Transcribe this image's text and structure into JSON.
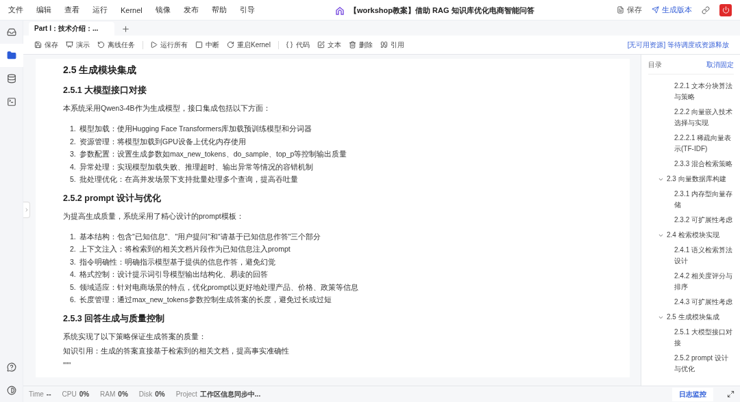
{
  "menu": [
    "文件",
    "编辑",
    "查看",
    "运行",
    "Kernel",
    "镜像",
    "发布",
    "帮助",
    "引导"
  ],
  "title": "【workshop教案】借助 RAG 知识库优化电商智能问答",
  "header_actions": [
    {
      "kind": "save",
      "label": "保存"
    },
    {
      "kind": "publish",
      "label": "生成版本"
    },
    {
      "kind": "link"
    },
    {
      "kind": "power"
    }
  ],
  "sidebar": [
    {
      "kind": "inbox",
      "selected": false
    },
    {
      "kind": "folder",
      "selected": true
    },
    {
      "kind": "database",
      "selected": false
    },
    {
      "kind": "terminal",
      "selected": false
    }
  ],
  "sidebar_bottom": [
    {
      "kind": "help"
    },
    {
      "kind": "theme"
    }
  ],
  "tabs": [
    {
      "label": "Part I：技术介绍：...",
      "selected": true
    }
  ],
  "toolbar": [
    {
      "kind": "save",
      "label": "保存"
    },
    {
      "kind": "present",
      "label": "演示"
    },
    {
      "kind": "offline",
      "label": "离线任务"
    },
    {
      "kind": "sep"
    },
    {
      "kind": "run",
      "label": "运行所有"
    },
    {
      "kind": "stop",
      "label": "中断"
    },
    {
      "kind": "restart",
      "label": "重启Kernel"
    },
    {
      "kind": "sep"
    },
    {
      "kind": "code",
      "label": "代码"
    },
    {
      "kind": "text",
      "label": "文本"
    },
    {
      "kind": "delete",
      "label": "删除"
    },
    {
      "kind": "quote",
      "label": "引用"
    }
  ],
  "resource_status": "[无可用资源] 等待调度或资源释放",
  "document": [
    {
      "kind": "h2",
      "text": "2.5 生成模块集成"
    },
    {
      "kind": "h3",
      "text": "2.5.1 大模型接口对接"
    },
    {
      "kind": "p",
      "text": "本系统采用Qwen3-4B作为生成模型，接口集成包括以下方面："
    },
    {
      "kind": "ol",
      "items": [
        {
          "number": "1.",
          "text": "模型加载：使用Hugging Face Transformers库加载预训练模型和分词器"
        },
        {
          "number": "2.",
          "text": "资源管理：将模型加载到GPU设备上优化内存使用"
        },
        {
          "number": "3.",
          "text": "参数配置：设置生成参数如max_new_tokens、do_sample、top_p等控制输出质量"
        },
        {
          "number": "4.",
          "text": "异常处理：实现模型加载失败、推理超时、输出异常等情况的容错机制"
        },
        {
          "number": "5.",
          "text": "批处理优化：在高并发场景下支持批量处理多个查询，提高吞吐量"
        }
      ]
    },
    {
      "kind": "h3",
      "text": "2.5.2 prompt 设计与优化"
    },
    {
      "kind": "p",
      "text": "为提高生成质量，系统采用了精心设计的prompt模板："
    },
    {
      "kind": "ol",
      "items": [
        {
          "number": "1.",
          "text": "基本结构：包含\"已知信息\"、\"用户提问\"和\"请基于已知信息作答\"三个部分"
        },
        {
          "number": "2.",
          "text": "上下文注入：将检索到的相关文档片段作为已知信息注入prompt"
        },
        {
          "number": "3.",
          "text": "指令明确性：明确指示模型基于提供的信息作答，避免幻觉"
        },
        {
          "number": "4.",
          "text": "格式控制：设计提示词引导模型输出结构化、易读的回答"
        },
        {
          "number": "5.",
          "text": "领域适应：针对电商场景的特点，优化prompt以更好地处理产品、价格、政策等信息"
        },
        {
          "number": "6.",
          "text": "长度管理：通过max_new_tokens参数控制生成答案的长度，避免过长或过短"
        }
      ]
    },
    {
      "kind": "h3",
      "text": "2.5.3 回答生成与质量控制"
    },
    {
      "kind": "p",
      "text": "系统实现了以下策略保证生成答案的质量："
    },
    {
      "kind": "p",
      "text": "知识引用：生成的答案直接基于检索到的相关文档，提高事实准确性"
    },
    {
      "kind": "p",
      "text": "\"\"\""
    }
  ],
  "toc": {
    "title": "目录",
    "unpin": "取消固定",
    "items": [
      {
        "children": [
          {
            "label": "2.2.1 文本分块算法与策略"
          },
          {
            "label": "2.2.2 向量嵌入技术选择与实现"
          },
          {
            "label": "2.2.2.1 稀疏向量表示(TF-IDF)"
          },
          {
            "label": "2.3.3 混合检索策略"
          }
        ]
      },
      {
        "label": "2.3 向量数据库构建",
        "expanded": true,
        "children": [
          {
            "label": "2.3.1 内存型向量存储"
          },
          {
            "label": "2.3.2 可扩展性考虑"
          }
        ]
      },
      {
        "label": "2.4 检索模块实现",
        "expanded": true,
        "children": [
          {
            "label": "2.4.1 语义检索算法设计"
          },
          {
            "label": "2.4.2 相关度评分与排序"
          },
          {
            "label": "2.4.3 可扩展性考虑"
          }
        ]
      },
      {
        "label": "2.5 生成模块集成",
        "expanded": true,
        "children": [
          {
            "label": "2.5.1 大模型接口对接"
          },
          {
            "label": "2.5.2 prompt 设计与优化"
          }
        ]
      }
    ]
  },
  "status": [
    {
      "label": "Time",
      "value": "--"
    },
    {
      "label": "CPU",
      "value": "0%"
    },
    {
      "label": "RAM",
      "value": "0%"
    },
    {
      "label": "Disk",
      "value": "0%"
    },
    {
      "label": "Project",
      "value": "工作区信息同步中..."
    }
  ],
  "log_button": "日志监控"
}
